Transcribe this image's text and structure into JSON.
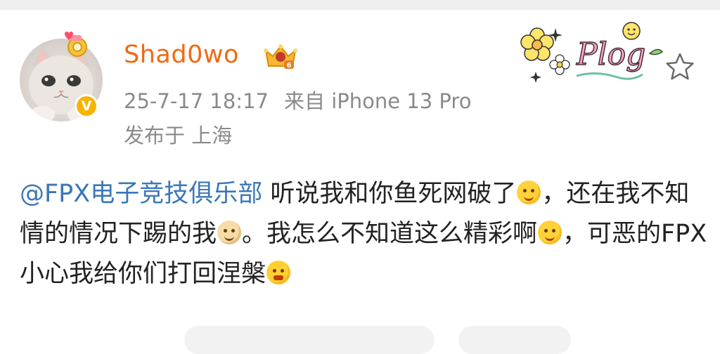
{
  "user": {
    "name": "Shad0wo",
    "verified_badge": "V"
  },
  "meta": {
    "timestamp": "25-7-17 18:17",
    "source": "来自 iPhone 13 Pro",
    "location": "发布于 上海"
  },
  "post": {
    "mention": "@FPX电子竞技俱乐部",
    "seg1": " 听说我和你鱼死网破了",
    "seg2": "，还在我不知情的情况下踢的我",
    "seg3": "。我怎么不知道这么精彩啊",
    "seg4": "，可恶的FPX小心我给你们打回涅槃",
    "emojis": [
      "sweat-smile-emoji",
      "doge-emoji",
      "smug-emoji",
      "angry-emoji"
    ]
  },
  "sticker": {
    "text": "Plog"
  },
  "icons": [
    "pendant-icon",
    "crown-icon",
    "star-icon"
  ],
  "colors": {
    "username": "#f06a13",
    "mention": "#3a77b8",
    "meta": "#8a8a8a",
    "badge": "#f8b400"
  }
}
